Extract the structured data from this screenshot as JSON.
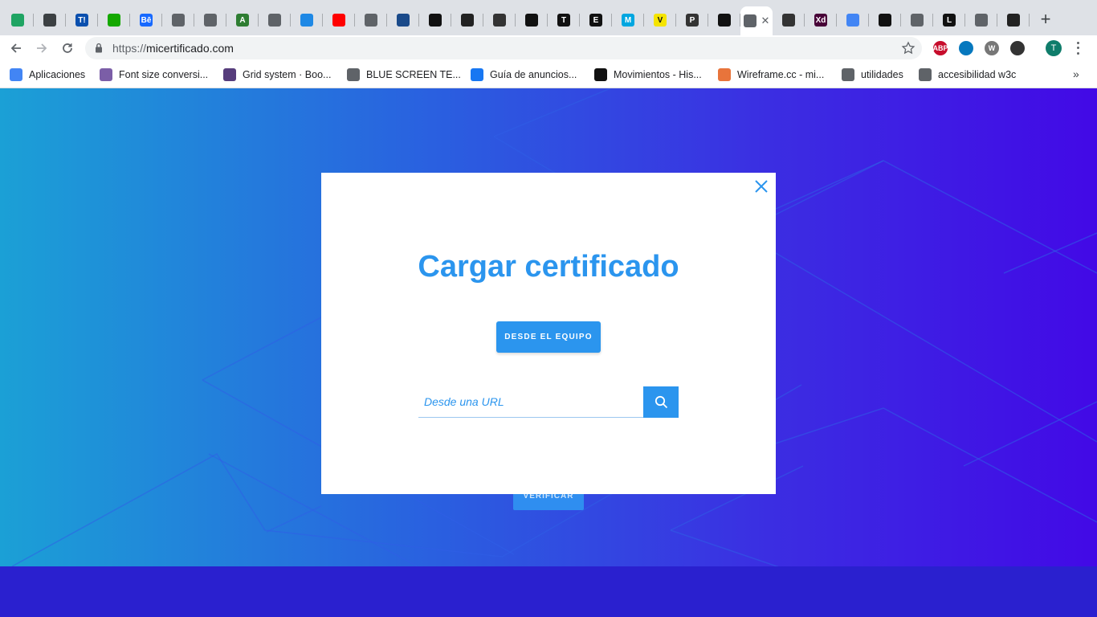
{
  "browser": {
    "tabs": [
      {
        "icon": "google-drive-icon",
        "label": "",
        "color": "#1fa463"
      },
      {
        "icon": "globe-icon",
        "label": "",
        "color": "#3c4043"
      },
      {
        "icon": "t-icon",
        "label": "T!",
        "color": "#0a4fae"
      },
      {
        "icon": "upwork-icon",
        "label": "",
        "color": "#14a800"
      },
      {
        "icon": "behance-icon",
        "label": "Bē",
        "color": "#1769ff"
      },
      {
        "icon": "globe-icon",
        "label": "",
        "color": "#5f6368"
      },
      {
        "icon": "camera-icon",
        "label": "",
        "color": "#5f6368"
      },
      {
        "icon": "a-icon",
        "label": "A",
        "color": "#2e7d32"
      },
      {
        "icon": "globe-icon",
        "label": "",
        "color": "#5f6368"
      },
      {
        "icon": "bird-icon",
        "label": "",
        "color": "#1e88e5"
      },
      {
        "icon": "youtube-icon",
        "label": "",
        "color": "#ff0000"
      },
      {
        "icon": "globe-icon",
        "label": "",
        "color": "#5f6368"
      },
      {
        "icon": "c-icon",
        "label": "",
        "color": "#1a4a8a"
      },
      {
        "icon": "underscore-icon",
        "label": "",
        "color": "#111111"
      },
      {
        "icon": "stripes-icon",
        "label": "",
        "color": "#222222"
      },
      {
        "icon": "face-icon",
        "label": "",
        "color": "#333333"
      },
      {
        "icon": "nyt-icon",
        "label": "",
        "color": "#111111"
      },
      {
        "icon": "t-serif-icon",
        "label": "T",
        "color": "#111111"
      },
      {
        "icon": "e-icon",
        "label": "E",
        "color": "#111111"
      },
      {
        "icon": "m-icon",
        "label": "M",
        "color": "#00a6e0"
      },
      {
        "icon": "v-icon",
        "label": "V",
        "color": "#f5e400"
      },
      {
        "icon": "p-icon",
        "label": "P",
        "color": "#333333"
      },
      {
        "icon": "ball-icon",
        "label": "",
        "color": "#111111"
      },
      {
        "icon": "loading-icon",
        "label": "",
        "color": "#5f6368"
      },
      {
        "icon": "e-circle-icon",
        "label": "",
        "color": "#333333"
      },
      {
        "icon": "xd-icon",
        "label": "Xd",
        "color": "#470137"
      },
      {
        "icon": "docs-icon",
        "label": "",
        "color": "#4285f4"
      },
      {
        "icon": "q-icon",
        "label": "",
        "color": "#111111"
      },
      {
        "icon": "stack-icon",
        "label": "",
        "color": "#5f6368"
      },
      {
        "icon": "l-icon",
        "label": "L",
        "color": "#111111"
      },
      {
        "icon": "globe-icon",
        "label": "",
        "color": "#5f6368"
      },
      {
        "icon": "circle-icon",
        "label": "",
        "color": "#222222"
      }
    ],
    "active_tab_index": 23,
    "new_tab_label": "+",
    "address": {
      "scheme": "https://",
      "host": "micertificado.com"
    },
    "profile_initial": "T",
    "extensions": [
      {
        "icon": "abp-icon",
        "label": "ABP",
        "color": "#c70d2c"
      },
      {
        "icon": "drupal-icon",
        "label": "",
        "color": "#0678be"
      },
      {
        "icon": "w-icon",
        "label": "W",
        "color": "#777777"
      },
      {
        "icon": "font-icon",
        "label": "",
        "color": "#333333"
      }
    ],
    "bookmarks": [
      {
        "icon": "apps-icon",
        "label": "Aplicaciones",
        "color": "#4285f4"
      },
      {
        "icon": "pinwheel-icon",
        "label": "Font size conversi...",
        "color": "#7b5ea7"
      },
      {
        "icon": "bootstrap-icon",
        "label": "Grid system · Boo...",
        "color": "#563d7c"
      },
      {
        "icon": "globe-icon",
        "label": "BLUE SCREEN TE...",
        "color": "#5f6368"
      },
      {
        "icon": "facebook-icon",
        "label": "Guía de anuncios...",
        "color": "#1877f2"
      },
      {
        "icon": "ha-icon",
        "label": "Movimientos - His...",
        "color": "#111111"
      },
      {
        "icon": "wireframe-icon",
        "label": "Wireframe.cc - mi...",
        "color": "#e8743b"
      },
      {
        "icon": "folder-icon",
        "label": "utilidades",
        "color": "#5f6368"
      },
      {
        "icon": "folder-icon",
        "label": "accesibilidad w3c",
        "color": "#5f6368"
      }
    ],
    "bookmarks_more": "»"
  },
  "page": {
    "verify_button": "VERIFICAR",
    "colors": {
      "gradient_start": "#1ba0d6",
      "gradient_end": "#4209e6",
      "accent": "#2b95ee"
    }
  },
  "modal": {
    "title": "Cargar certificado",
    "upload_button": "DESDE EL EQUIPO",
    "url_placeholder": "Desde una URL",
    "url_value": ""
  }
}
